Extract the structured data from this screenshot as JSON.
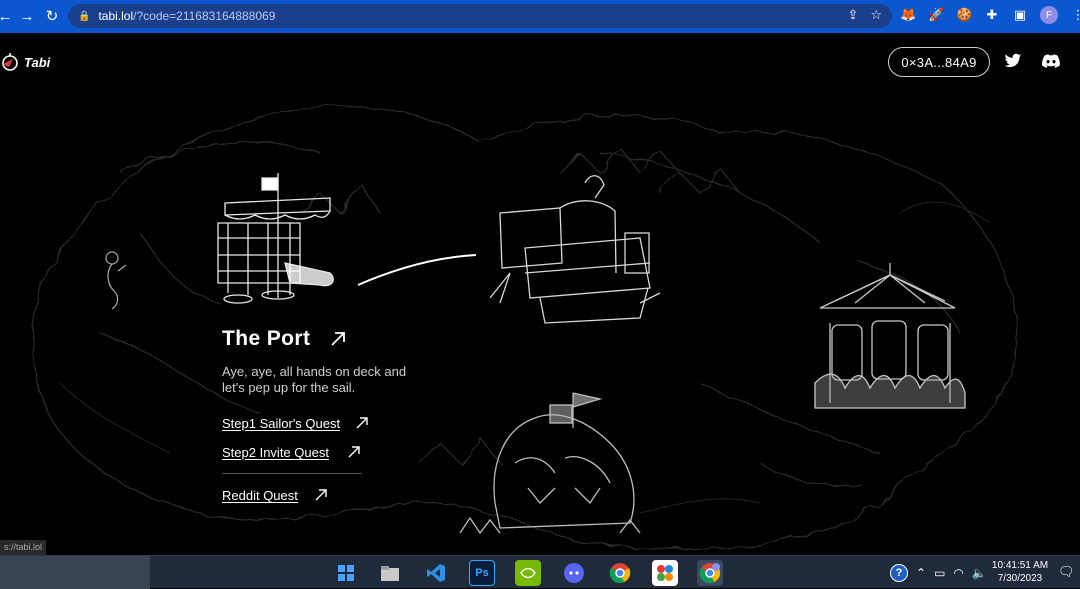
{
  "browser": {
    "url_host": "tabi.lol",
    "url_rest": "/?code=211683164888069",
    "profile_initial": "F"
  },
  "site": {
    "logo_text": "Tabi",
    "wallet_label": "0×3A...84A9"
  },
  "port": {
    "title": "The Port",
    "description": "Aye, aye, all hands on deck and let's pep up for the sail.",
    "quests": [
      {
        "label": "Step1 Sailor's Quest"
      },
      {
        "label": "Step2 Invite Quest"
      },
      {
        "label": "Reddit Quest"
      }
    ]
  },
  "status_bar": {
    "text": "s://tabi.lol"
  },
  "taskbar": {
    "time": "10:41:51 AM",
    "date": "7/30/2023",
    "ps_label": "Ps"
  },
  "icons": {
    "back": "back-arrow-icon",
    "forward": "forward-arrow-icon",
    "reload": "reload-icon",
    "share": "share-icon",
    "bookmark": "star-icon",
    "twitter": "twitter-icon",
    "discord": "discord-icon"
  },
  "colors": {
    "browser_blue": "#0b57d0",
    "page_bg": "#000000",
    "taskbar_bg": "#1f2a3a"
  }
}
